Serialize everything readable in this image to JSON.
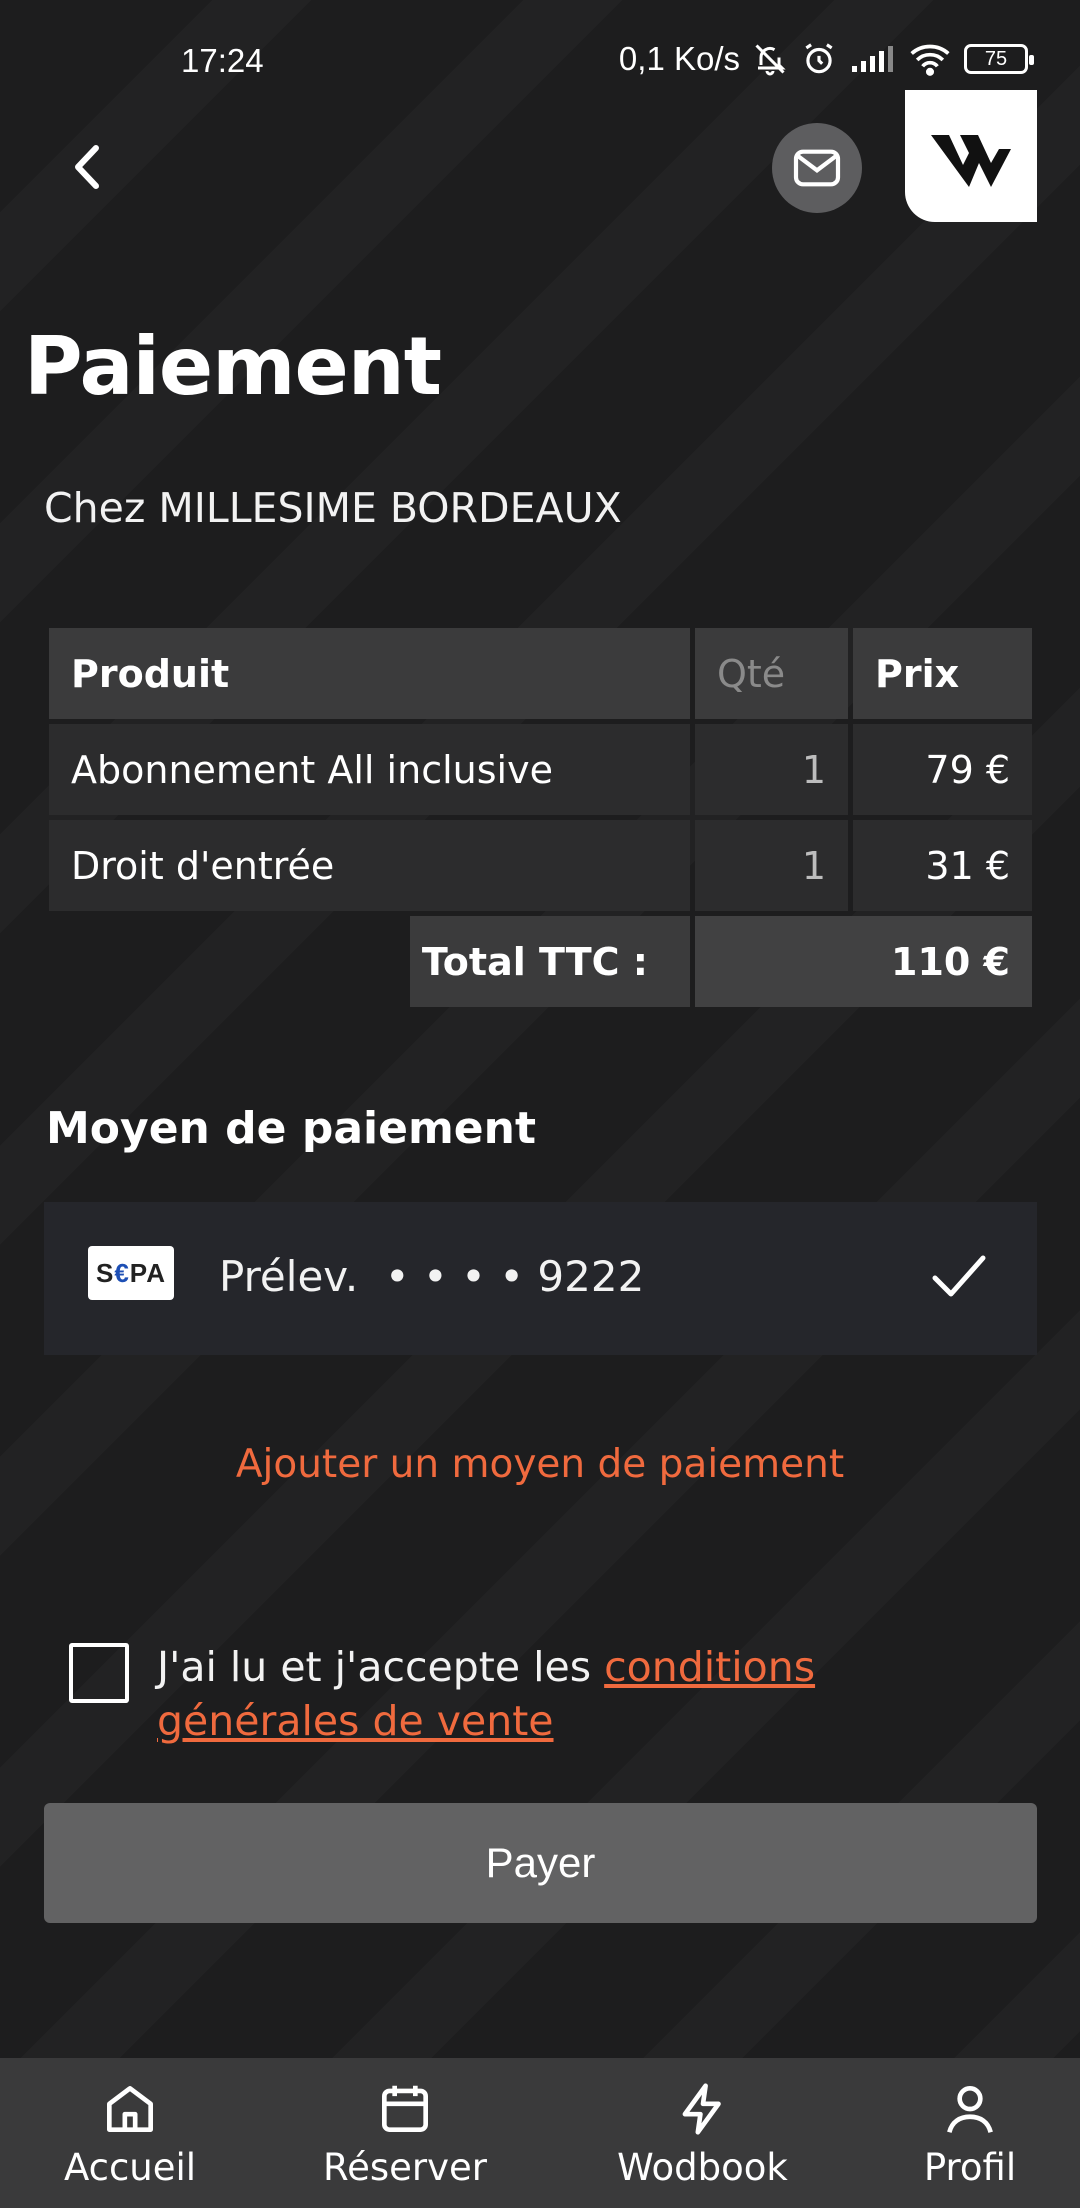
{
  "status_bar": {
    "time": "17:24",
    "network_speed": "0,1 Ko/s",
    "battery": "75"
  },
  "header": {
    "back_icon": "chevron-left-icon",
    "mail_icon": "mail-icon",
    "logo": "W"
  },
  "page": {
    "title": "Paiement",
    "subtitle": "Chez MILLESIME BORDEAUX"
  },
  "order_table": {
    "headers": {
      "product": "Produit",
      "qty": "Qté",
      "price": "Prix"
    },
    "rows": [
      {
        "product": "Abonnement All inclusive",
        "qty": "1",
        "price": "79 €"
      },
      {
        "product": "Droit d'entrée",
        "qty": "1",
        "price": "31 €"
      }
    ],
    "total_label": "Total TTC :",
    "total_value": "110 €"
  },
  "payment_method": {
    "section_title": "Moyen de paiement",
    "badge": {
      "prefix": "S",
      "euro": "€",
      "suffix": "PA"
    },
    "label": "Prélev.  • • • • 9222",
    "selected": true,
    "add_link": "Ajouter un moyen de paiement"
  },
  "terms": {
    "text": "J'ai lu et j'accepte les ",
    "link": "conditions générales de vente",
    "checked": false
  },
  "pay_button": "Payer",
  "bottom_nav": [
    {
      "label": "Accueil",
      "icon": "home-icon"
    },
    {
      "label": "Réserver",
      "icon": "calendar-icon"
    },
    {
      "label": "Wodbook",
      "icon": "lightning-icon"
    },
    {
      "label": "Profil",
      "icon": "user-icon"
    }
  ],
  "colors": {
    "background": "#1d1d1e",
    "accent": "#f06a3e",
    "button": "#626263",
    "nav": "#3a3a3b"
  }
}
